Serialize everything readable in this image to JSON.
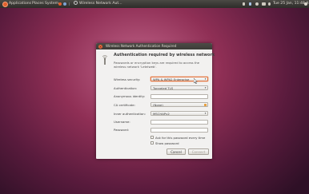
{
  "panel": {
    "applications": "Applications",
    "places": "Places",
    "system": "System",
    "window_title": "Wireless Network Aut...",
    "clock": "Tue 25 Jan, 11:48 AM"
  },
  "dialog": {
    "title": "Wireless Network Authentication Required",
    "heading": "Authentication required by wireless network",
    "description": "Passwords or encryption keys are required to access the wireless network 'Letelweb'.",
    "fields": {
      "wireless_security": {
        "label": "Wireless security:",
        "value": "WPA & WPA2 Enterprise"
      },
      "authentication": {
        "label": "Authentication:",
        "value": "Tunneled TLS"
      },
      "anonymous_identity": {
        "label": "Anonymous identity:",
        "value": ""
      },
      "ca_certificate": {
        "label": "CA certificate:",
        "value": "(None)"
      },
      "inner_authentication": {
        "label": "Inner authentication:",
        "value": "MSCHAPv2"
      },
      "username": {
        "label": "Username:",
        "value": ""
      },
      "password": {
        "label": "Password:",
        "value": ""
      }
    },
    "ask_password": "Ask for this password every time",
    "show_password": "Show password",
    "cancel": "Cancel",
    "connect": "Connect"
  }
}
